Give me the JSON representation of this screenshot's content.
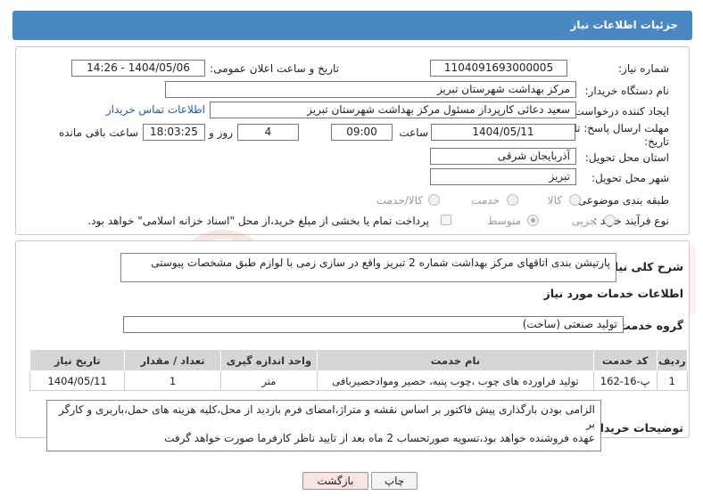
{
  "header": {
    "title": "جزئیات اطلاعات نیاز"
  },
  "form": {
    "need_number_label": "شماره نیاز:",
    "need_number_value": "1104091693000005",
    "announce_label": "تاریخ و ساعت اعلان عمومی:",
    "announce_value": "1404/05/06 - 14:26",
    "buyer_org_label": "نام دستگاه خریدار:",
    "buyer_org_value": "مرکز بهداشت شهرستان تبریز",
    "creator_label": "ایجاد کننده درخواست:",
    "creator_value": "سعید دعائی کارپرداز مسئول مرکز بهداشت شهرستان تبریز",
    "contact_link": "اطلاعات تماس خریدار",
    "deadline_label_line1": "مهلت ارسال پاسخ: تا",
    "deadline_label_line2": "تاریخ:",
    "deadline_date": "1404/05/11",
    "time_label": "ساعت",
    "deadline_time": "09:00",
    "days_value": "4",
    "days_label": "روز و",
    "remaining_time": "18:03:25",
    "remaining_label": "ساعت باقی مانده",
    "province_label": "استان محل تحویل:",
    "province_value": "آذربایجان شرقی",
    "city_label": "شهر محل تحویل:",
    "city_value": "تبریز",
    "category_label": "طبقه بندی موضوعی:",
    "category_options": [
      "کالا",
      "خدمت",
      "کالا/خدمت"
    ],
    "process_label": "نوع فرآیند خرید :",
    "process_options": [
      "جزیی",
      "متوسط"
    ],
    "payment_note": "پرداخت تمام یا بخشی از مبلغ خرید،از محل \"اسناد خزانه اسلامی\" خواهد بود."
  },
  "description": {
    "label": "شرح کلی نیاز:",
    "value": "پارتیشن بندی اتاقهای مرکز بهداشت شماره 2 تبریز واقع در سازی زمی با لوازم طبق مشخصات پیوستی"
  },
  "services": {
    "section_title": "اطلاعات خدمات مورد نیاز",
    "group_label": "گروه خدمت:",
    "group_value": "تولید صنعتی (ساخت)",
    "columns": [
      "ردیف",
      "کد خدمت",
      "نام خدمت",
      "واحد اندازه گیری",
      "تعداد / مقدار",
      "تاریخ نیاز"
    ],
    "rows": [
      {
        "row": "1",
        "code": "پ-16-162",
        "name": "تولید فراورده های چوب ،چوب پنبه، حصیر وموادحصیربافی",
        "unit": "متر",
        "qty": "1",
        "date": "1404/05/11"
      }
    ]
  },
  "buyer_notes": {
    "label": "توضیحات خریدار:",
    "line1": "الزامی بودن بارگذاری پیش فاکتور بر اساس نقشه و متراژ،امضای فرم بازدید از محل،کلیه هزینه های حمل،باربری و کارگر بر",
    "line2": "عهده فروشنده خواهد بود،تسویه صورتحساب 2 ماه بعد از تایید ناظر کارفرما صورت خواهد گرفت"
  },
  "buttons": {
    "print": "چاپ",
    "back": "بازگشت"
  },
  "colors": {
    "header": "#4a88c4",
    "link": "#1a5fb4",
    "back_button": "#fbe3e3"
  }
}
